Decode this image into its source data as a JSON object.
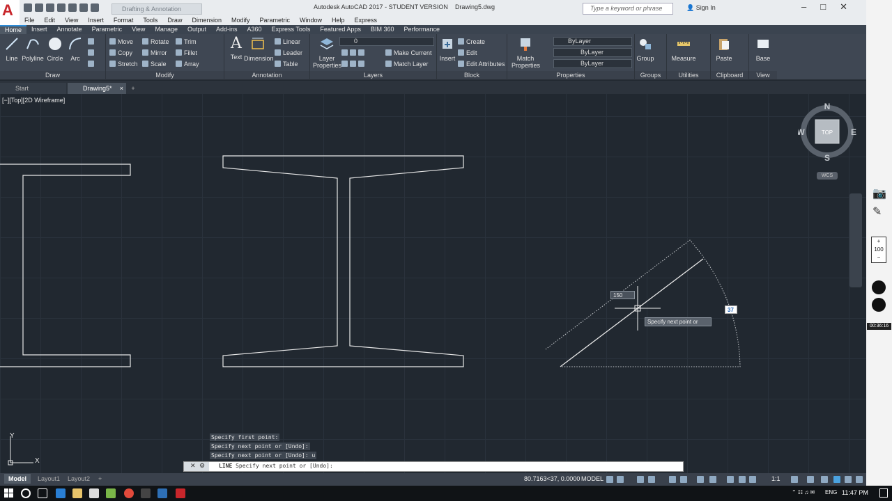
{
  "title": {
    "app": "Autodesk AutoCAD 2017 - STUDENT VERSION",
    "file": "Drawing5.dwg",
    "workspace": "Drafting & Annotation",
    "search_placeholder": "Type a keyword or phrase",
    "signin": "Sign In"
  },
  "menu": [
    "File",
    "Edit",
    "View",
    "Insert",
    "Format",
    "Tools",
    "Draw",
    "Dimension",
    "Modify",
    "Parametric",
    "Window",
    "Help",
    "Express"
  ],
  "ribbon_tabs": [
    "Home",
    "Insert",
    "Annotate",
    "Parametric",
    "View",
    "Manage",
    "Output",
    "Add-ins",
    "A360",
    "Express Tools",
    "Featured Apps",
    "BIM 360",
    "Performance"
  ],
  "ribbon": {
    "draw": {
      "title": "Draw",
      "line": "Line",
      "polyline": "Polyline",
      "circle": "Circle",
      "arc": "Arc"
    },
    "modify": {
      "title": "Modify",
      "move": "Move",
      "rotate": "Rotate",
      "trim": "Trim",
      "copy": "Copy",
      "mirror": "Mirror",
      "fillet": "Fillet",
      "stretch": "Stretch",
      "scale": "Scale",
      "array": "Array"
    },
    "annotation": {
      "title": "Annotation",
      "text": "Text",
      "dimension": "Dimension",
      "linear": "Linear",
      "leader": "Leader",
      "table": "Table"
    },
    "layers": {
      "title": "Layers",
      "layer_properties_1": "Layer",
      "layer_properties_2": "Properties",
      "layer_value": "0",
      "make_current": "Make Current",
      "match_layer": "Match Layer"
    },
    "block": {
      "title": "Block",
      "insert": "Insert",
      "create": "Create",
      "edit": "Edit",
      "edit_attributes": "Edit Attributes"
    },
    "properties": {
      "title": "Properties",
      "match_1": "Match",
      "match_2": "Properties",
      "color": "ByLayer",
      "linetype": "ByLayer",
      "lineweight": "ByLayer"
    },
    "groups": {
      "title": "Groups",
      "group": "Group"
    },
    "utilities": {
      "title": "Utilities",
      "measure": "Measure"
    },
    "clipboard": {
      "title": "Clipboard",
      "paste": "Paste"
    },
    "view": {
      "title": "View",
      "base": "Base"
    }
  },
  "file_tabs": {
    "start": "Start",
    "drawing": "Drawing5*"
  },
  "viewport": {
    "label": "[−][Top][2D Wireframe]",
    "compass": {
      "n": "N",
      "s": "S",
      "e": "E",
      "w": "W",
      "top": "TOP"
    },
    "wcs": "WCS",
    "ucs_x": "X",
    "ucs_y": "Y"
  },
  "dynamic_input": {
    "length": "150",
    "angle": "37",
    "prompt": "Specify next point or"
  },
  "command_history": [
    "Specify first point:",
    "Specify next point or [Undo]:",
    "Specify next point or [Undo]: u"
  ],
  "command_line": {
    "prefix": "LINE",
    "text": "Specify next point or [Undo]:"
  },
  "status": {
    "layout_tabs": [
      "Model",
      "Layout1",
      "Layout2"
    ],
    "coords": "80.7163<37, 0.0000",
    "model": "MODEL",
    "scale": "1:1"
  },
  "recorder": {
    "zoom": "100",
    "timer": "00:36:16"
  },
  "taskbar": {
    "lang": "ENG",
    "clock": "11:47 PM"
  }
}
